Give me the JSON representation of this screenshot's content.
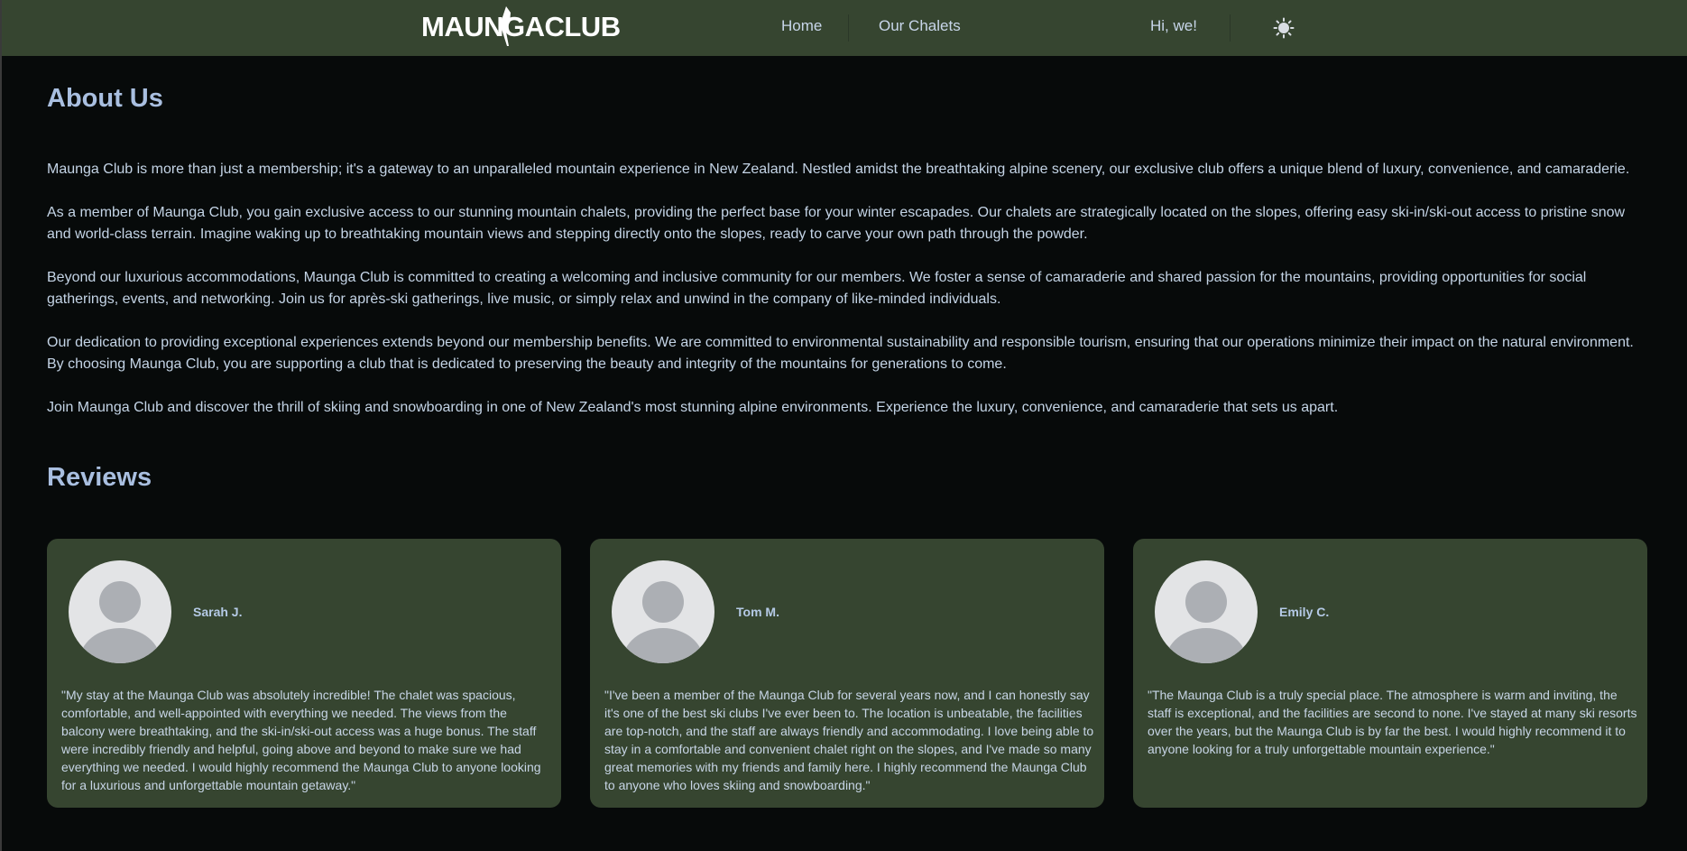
{
  "header": {
    "logo_text": "MAUNGACLUB",
    "nav": [
      {
        "label": "Home"
      },
      {
        "label": "Our Chalets"
      }
    ],
    "greeting": "Hi, we!",
    "theme_icon": "sun-icon"
  },
  "about": {
    "title": "About Us",
    "paragraphs": [
      "Maunga Club is more than just a membership; it's a gateway to an unparalleled mountain experience in New Zealand. Nestled amidst the breathtaking alpine scenery, our exclusive club offers a unique blend of luxury, convenience, and camaraderie.",
      "As a member of Maunga Club, you gain exclusive access to our stunning mountain chalets, providing the perfect base for your winter escapades. Our chalets are strategically located on the slopes, offering easy ski-in/ski-out access to pristine snow and world-class terrain. Imagine waking up to breathtaking mountain views and stepping directly onto the slopes, ready to carve your own path through the powder.",
      "Beyond our luxurious accommodations, Maunga Club is committed to creating a welcoming and inclusive community for our members. We foster a sense of camaraderie and shared passion for the mountains, providing opportunities for social gatherings, events, and networking. Join us for après-ski gatherings, live music, or simply relax and unwind in the company of like-minded individuals.",
      "Our dedication to providing exceptional experiences extends beyond our membership benefits. We are committed to environmental sustainability and responsible tourism, ensuring that our operations minimize their impact on the natural environment. By choosing Maunga Club, you are supporting a club that is dedicated to preserving the beauty and integrity of the mountains for generations to come.",
      "Join Maunga Club and discover the thrill of skiing and snowboarding in one of New Zealand's most stunning alpine environments. Experience the luxury, convenience, and camaraderie that sets us apart."
    ]
  },
  "reviews": {
    "title": "Reviews",
    "items": [
      {
        "name": "Sarah J.",
        "text": "\"My stay at the Maunga Club was absolutely incredible! The chalet was spacious, comfortable, and well-appointed with everything we needed. The views from the balcony were breathtaking, and the ski-in/ski-out access was a huge bonus. The staff were incredibly friendly and helpful, going above and beyond to make sure we had everything we needed. I would highly recommend the Maunga Club to anyone looking for a luxurious and unforgettable mountain getaway.\""
      },
      {
        "name": "Tom M.",
        "text": "\"I've been a member of the Maunga Club for several years now, and I can honestly say it's one of the best ski clubs I've ever been to. The location is unbeatable, the facilities are top-notch, and the staff are always friendly and accommodating. I love being able to stay in a comfortable and convenient chalet right on the slopes, and I've made so many great memories with my friends and family here. I highly recommend the Maunga Club to anyone who loves skiing and snowboarding.\""
      },
      {
        "name": "Emily C.",
        "text": "\"The Maunga Club is a truly special place. The atmosphere is warm and inviting, the staff is exceptional, and the facilities are second to none. I've stayed at many ski resorts over the years, but the Maunga Club is by far the best. I would highly recommend it to anyone looking for a truly unforgettable mountain experience.\""
      }
    ]
  },
  "colors": {
    "nav_bg": "#364530",
    "page_bg": "#070a0a",
    "heading": "#a9bfe0",
    "text": "#c4d4e6"
  }
}
